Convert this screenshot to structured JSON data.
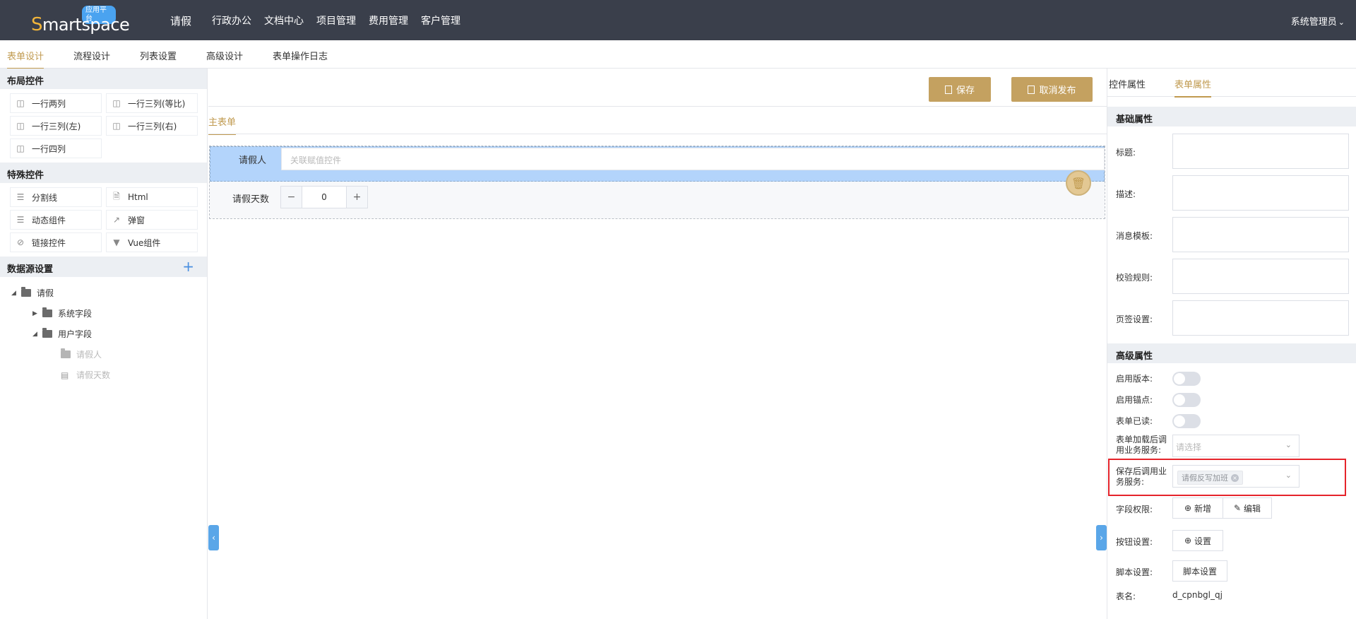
{
  "header": {
    "logo_badge": "应用平台",
    "logo_initial": "S",
    "logo_rest": "martspace",
    "app_title": "请假",
    "nav": [
      "行政办公",
      "文档中心",
      "项目管理",
      "费用管理",
      "客户管理"
    ],
    "user": "系统管理员"
  },
  "subtabs": [
    "表单设计",
    "流程设计",
    "列表设置",
    "高级设计",
    "表单操作日志"
  ],
  "left": {
    "layout_title": "布局控件",
    "layout_controls": [
      "一行两列",
      "一行三列(等比)",
      "一行三列(左)",
      "一行三列(右)",
      "一行四列"
    ],
    "special_title": "特殊控件",
    "special_controls": [
      {
        "label": "分割线",
        "icon": "divider-icon"
      },
      {
        "label": "Html",
        "icon": "html-file-icon"
      },
      {
        "label": "动态组件",
        "icon": "dynamic-icon"
      },
      {
        "label": "弹窗",
        "icon": "popup-icon"
      },
      {
        "label": "链接控件",
        "icon": "link-icon"
      },
      {
        "label": "Vue组件",
        "icon": "vue-icon"
      }
    ],
    "datasource_title": "数据源设置",
    "tree": {
      "root": "请假",
      "system_fields": "系统字段",
      "user_fields": "用户字段",
      "field1": "请假人",
      "field2": "请假天数"
    }
  },
  "center": {
    "save": "保存",
    "unpublish": "取消发布",
    "main_tab": "主表单",
    "field1_label": "请假人",
    "field1_placeholder": "关联赋值控件",
    "field2_label": "请假天数",
    "field2_value": "0"
  },
  "right": {
    "tab_control": "控件属性",
    "tab_form": "表单属性",
    "basic_title": "基础属性",
    "basic_props": [
      "标题:",
      "描述:",
      "消息模板:",
      "校验规则:",
      "页签设置:"
    ],
    "advanced_title": "高级属性",
    "enable_version": "启用版本:",
    "enable_anchor": "启用锚点:",
    "form_read": "表单已读:",
    "after_load_l1": "表单加载后调",
    "after_load_l2": "用业务服务:",
    "after_load_placeholder": "请选择",
    "after_save_l1": "保存后调用业",
    "after_save_l2": "务服务:",
    "after_save_tag": "请假反写加班",
    "field_perm": "字段权限:",
    "add": "新增",
    "edit": "编辑",
    "button_settings": "按钮设置:",
    "settings": "设置",
    "script_settings": "脚本设置:",
    "script_button": "脚本设置",
    "table_name_label": "表名:",
    "table_name": "d_cpnbgl_qj"
  },
  "colors": {
    "header_bg": "#3a3f4b",
    "accent": "#c09a4f",
    "gold_button": "#c4a160",
    "selected_row": "#b3d4fb",
    "highlight_border": "#e5242b",
    "side_arrow": "#5aa6e8"
  }
}
